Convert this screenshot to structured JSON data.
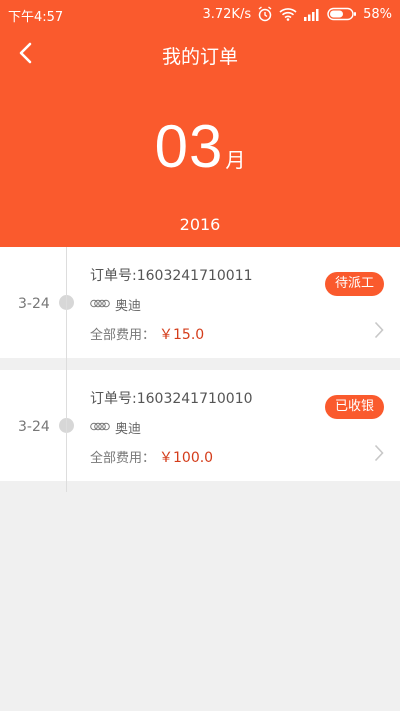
{
  "status_bar": {
    "time": "下午4:57",
    "speed": "3.72K/s",
    "battery": "58%",
    "icons": [
      "alarm-icon",
      "wifi-icon",
      "signal-icon",
      "battery-icon"
    ]
  },
  "nav": {
    "title": "我的订单",
    "back_icon": "chevron-left-icon"
  },
  "header": {
    "month": "03",
    "month_unit": "月",
    "year": "2016"
  },
  "orders": [
    {
      "date": "3-24",
      "order_label": "订单号:",
      "order_no": "1603241710011",
      "brand": "奥迪",
      "fee_label": "全部费用：",
      "price": "￥15.0",
      "status": "待派工"
    },
    {
      "date": "3-24",
      "order_label": "订单号:",
      "order_no": "1603241710010",
      "brand": "奥迪",
      "fee_label": "全部费用：",
      "price": "￥100.0",
      "status": "已收银"
    }
  ],
  "colors": {
    "accent": "#fa5a2d",
    "price": "#d43d1b",
    "background": "#f0f0f0"
  }
}
